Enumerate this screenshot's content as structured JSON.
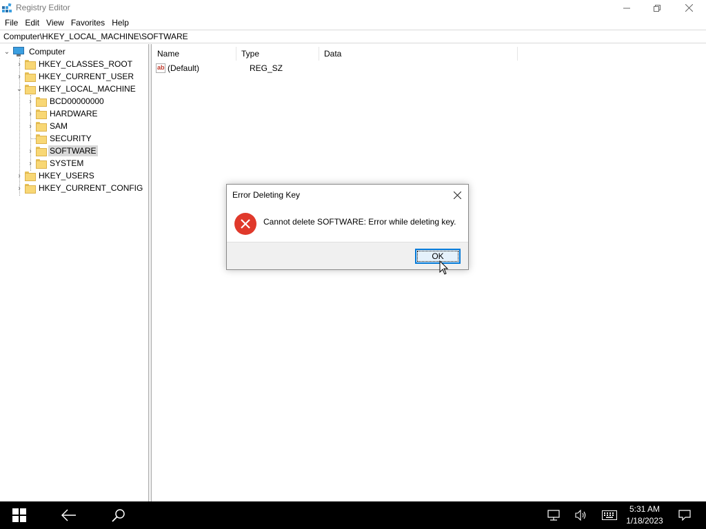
{
  "window": {
    "title": "Registry Editor"
  },
  "menu": [
    "File",
    "Edit",
    "View",
    "Favorites",
    "Help"
  ],
  "address": "Computer\\HKEY_LOCAL_MACHINE\\SOFTWARE",
  "tree": {
    "root": "Computer",
    "hives": {
      "classes_root": "HKEY_CLASSES_ROOT",
      "current_user": "HKEY_CURRENT_USER",
      "local_machine": "HKEY_LOCAL_MACHINE",
      "users": "HKEY_USERS",
      "current_config": "HKEY_CURRENT_CONFIG"
    },
    "local_machine_children": [
      "BCD00000000",
      "HARDWARE",
      "SAM",
      "SECURITY",
      "SOFTWARE",
      "SYSTEM"
    ],
    "selected": "SOFTWARE"
  },
  "list": {
    "columns": {
      "name": "Name",
      "type": "Type",
      "data": "Data"
    },
    "rows": [
      {
        "name": "(Default)",
        "type": "REG_SZ",
        "data": ""
      }
    ]
  },
  "dialog": {
    "title": "Error Deleting Key",
    "message": "Cannot delete SOFTWARE:  Error while deleting key.",
    "ok_label": "OK"
  },
  "taskbar": {
    "time": "5:31 AM",
    "date": "1/18/2023"
  },
  "colors": {
    "error_red": "#e0392b",
    "focus_blue": "#0078d7",
    "folder_yellow": "#f8d775",
    "taskbar": "#000000"
  }
}
